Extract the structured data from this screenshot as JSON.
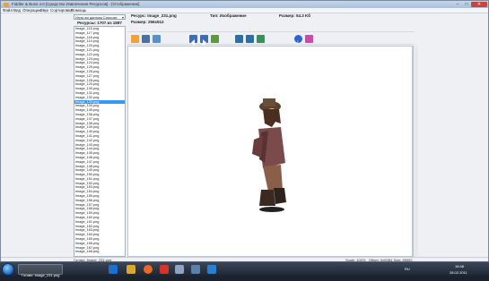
{
  "window": {
    "title": "Fiddler & Boss 4.0 [Средство Извлечения Ресурсов] - [Отображение]",
    "min": "–",
    "max": "□",
    "close": "✕"
  },
  "menu": [
    "Файл",
    "Вид",
    "Операции",
    "Звук",
    "Сортировка",
    "Помощь"
  ],
  "sidebar": {
    "filter_value": "Игры во данном Списоке",
    "resources_label": "Ресурсы: 1707 из 1887",
    "items": [
      "Image_116.png",
      "Image_117.png",
      "Image_118.png",
      "Image_119.png",
      "Image_120.png",
      "Image_121.png",
      "Image_122.png",
      "Image_123.png",
      "Image_124.png",
      "Image_125.png",
      "Image_126.png",
      "Image_127.png",
      "Image_128.png",
      "Image_129.png",
      "Image_130.png",
      "Image_131.png",
      "Image_132.png",
      "Image_133.png",
      "Image_134.png",
      "Image_135.png",
      "Image_136.png",
      "Image_137.png",
      "Image_138.png",
      "Image_139.png",
      "Image_140.png",
      "Image_141.png",
      "Image_142.png",
      "Image_143.png",
      "Image_144.png",
      "Image_145.png",
      "Image_146.png",
      "Image_147.png",
      "Image_148.png",
      "Image_149.png",
      "Image_150.png",
      "Image_151.png",
      "Image_152.png",
      "Image_153.png",
      "Image_154.png",
      "Image_155.png",
      "Image_156.png",
      "Image_157.png",
      "Image_158.png",
      "Image_159.png",
      "Image_160.png",
      "Image_161.png",
      "Image_162.png",
      "Image_163.png",
      "Image_164.png",
      "Image_165.png",
      "Image_166.png",
      "Image_167.png",
      "Image_168.png"
    ],
    "selected_index": 17
  },
  "info": {
    "resource": "Ресурс: Image_231.png",
    "type": "Тип: Изображение",
    "size": "Размер: 54.3 Kб",
    "dimensions": "Размер: 256x512"
  },
  "toolbar_icons": [
    "folder-open-icon",
    "save-icon",
    "export-icon",
    "prev-icon",
    "next-icon",
    "play-icon",
    "view-mode-1-icon",
    "view-mode-2-icon",
    "view-mode-3-icon",
    "help-icon",
    "settings-icon"
  ],
  "status": {
    "left": "Готово: Image_231.png",
    "zoom": "Scale: 100%",
    "offset": "Offset: 0x00B4 Size: 55552"
  },
  "taskbar": {
    "time": "18:48",
    "date": "28.02.2011",
    "lang": "RU"
  },
  "colors": {
    "selection": "#3399ff",
    "taskbar": "#1e2632",
    "close_button": "#c9453a"
  }
}
